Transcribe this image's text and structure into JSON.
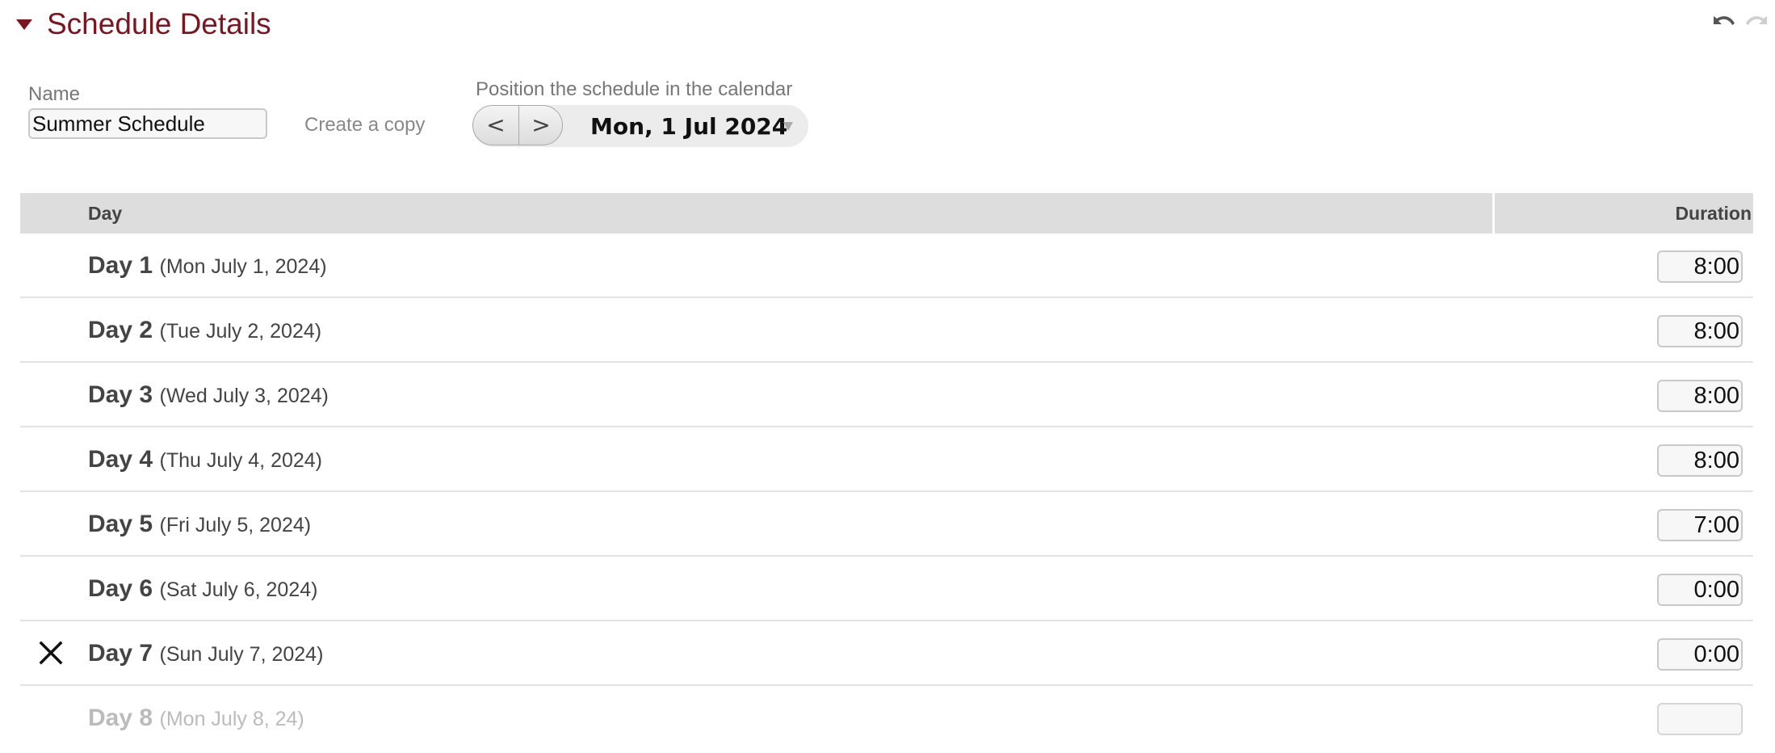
{
  "section": {
    "title": "Schedule Details"
  },
  "form": {
    "name_label": "Name",
    "name_value": "Summer Schedule",
    "copy_label": "Create a copy",
    "position_label": "Position the schedule in the calendar",
    "prev_label": "<",
    "next_label": ">",
    "date_value": "Mon, 1 Jul 2024"
  },
  "table": {
    "headers": {
      "day": "Day",
      "duration": "Duration"
    },
    "rows": [
      {
        "day": "Day 1",
        "date": "(Mon July 1, 2024)",
        "duration": "8:00"
      },
      {
        "day": "Day 2",
        "date": "(Tue July 2, 2024)",
        "duration": "8:00"
      },
      {
        "day": "Day 3",
        "date": "(Wed July 3, 2024)",
        "duration": "8:00"
      },
      {
        "day": "Day 4",
        "date": "(Thu July 4, 2024)",
        "duration": "8:00"
      },
      {
        "day": "Day 5",
        "date": "(Fri July 5, 2024)",
        "duration": "7:00"
      },
      {
        "day": "Day 6",
        "date": "(Sat July 6, 2024)",
        "duration": "0:00"
      },
      {
        "day": "Day 7",
        "date": "(Sun July 7, 2024)",
        "duration": "0:00",
        "marker": "close-icon"
      },
      {
        "day": "Day 8",
        "date": "(Mon July 8, 24)",
        "duration": "",
        "state": "placeholder"
      }
    ]
  },
  "colors": {
    "accent": "#7a1620",
    "header_bg": "#dddddd",
    "placeholder_text": "#bbbbbb"
  },
  "icons": [
    "disclosure-triangle-icon",
    "undo-icon",
    "redo-icon",
    "close-icon",
    "dropdown-caret-icon"
  ]
}
